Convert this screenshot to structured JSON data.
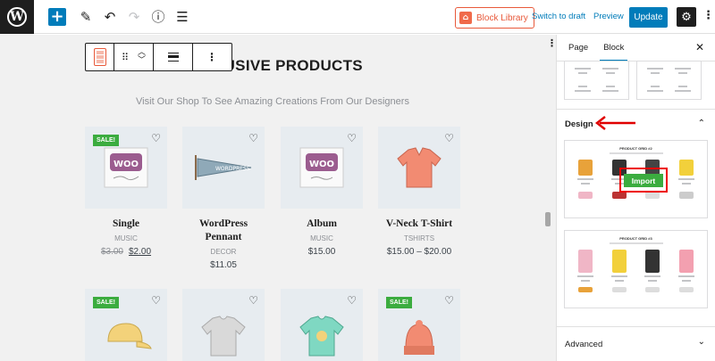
{
  "topbar": {
    "logo_letter": "W",
    "add": "+",
    "block_library": "Block Library",
    "switch_to_draft": "Switch to draft",
    "preview": "Preview",
    "update": "Update"
  },
  "canvas": {
    "title": "EXCLUSIVE PRODUCTS",
    "subtitle": "Visit Our Shop To See Amazing Creations From Our Designers",
    "sale_label": "SALE!",
    "products": [
      {
        "name": "Single",
        "category": "MUSIC",
        "old_price": "$3.00",
        "price": "$2.00",
        "sale": true
      },
      {
        "name": "WordPress Pennant",
        "category": "DECOR",
        "old_price": "",
        "price": "$11.05",
        "sale": false
      },
      {
        "name": "Album",
        "category": "MUSIC",
        "old_price": "",
        "price": "$15.00",
        "sale": false
      },
      {
        "name": "V-Neck T-Shirt",
        "category": "TSHIRTS",
        "old_price": "",
        "price": "$15.00 – $20.00",
        "sale": false
      }
    ],
    "row2_sale": [
      true,
      false,
      false,
      true
    ]
  },
  "sidebar": {
    "tab_page": "Page",
    "tab_block": "Block",
    "design_heading": "Design",
    "advanced_heading": "Advanced",
    "thumb1_title": "PRODUCT GRID #2",
    "thumb2_title": "PRODUCT GRID #3",
    "import_label": "Import"
  },
  "colors": {
    "accent": "#007cba",
    "sale_green": "#3bac3f",
    "library_orange": "#e8593a",
    "annotation_red": "#e00000"
  }
}
